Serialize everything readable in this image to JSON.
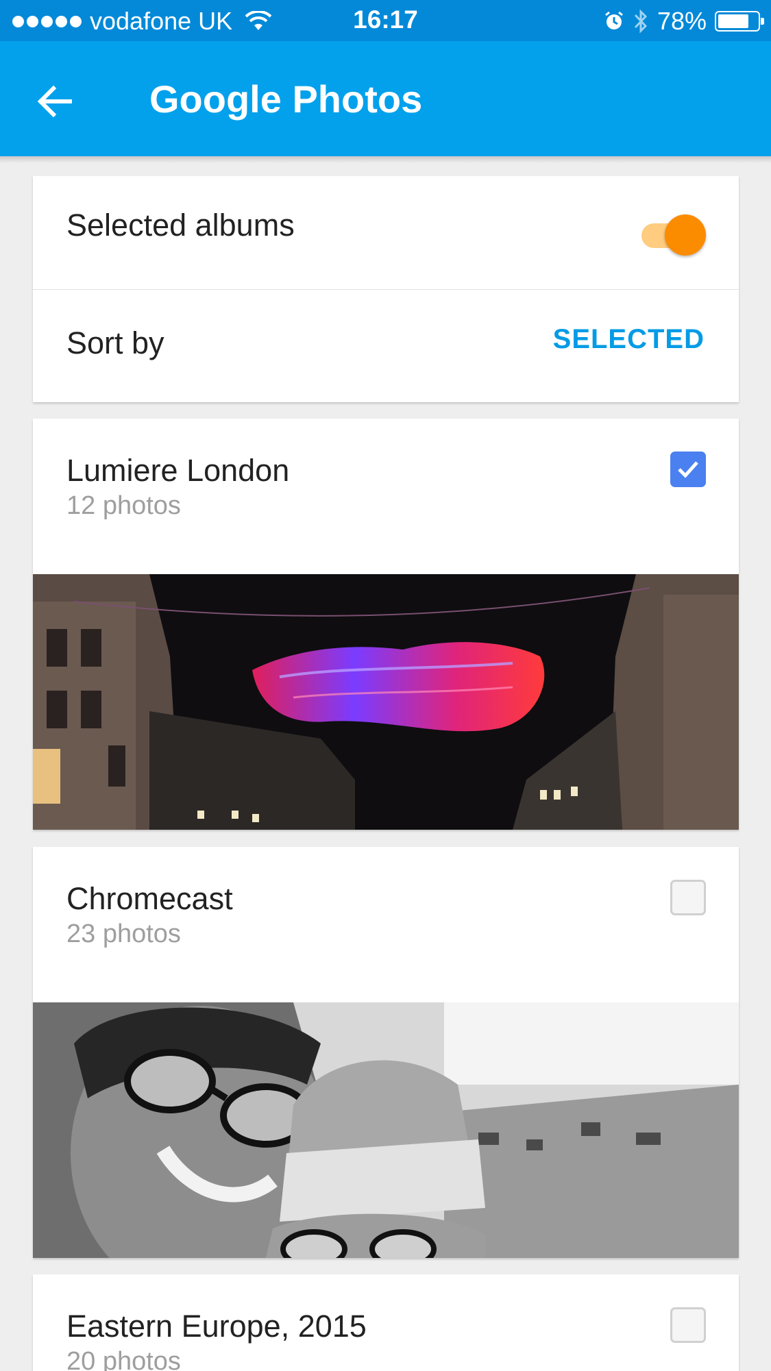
{
  "status_bar": {
    "carrier": "vodafone UK",
    "time": "16:17",
    "battery": "78%",
    "battery_level": 0.78
  },
  "app_bar": {
    "title": "Google Photos",
    "back_icon": "arrow-left-icon"
  },
  "settings": {
    "selected_albums_label": "Selected albums",
    "selected_albums_on": true,
    "sort_by_label": "Sort by",
    "sort_by_value": "SELECTED"
  },
  "albums": [
    {
      "name": "Lumiere London",
      "count": "12 photos",
      "checked": true
    },
    {
      "name": "Chromecast",
      "count": "23 photos",
      "checked": false
    },
    {
      "name": "Eastern Europe, 2015",
      "count": "20 photos",
      "checked": false
    }
  ],
  "colors": {
    "status_bar": "#0389d8",
    "app_bar": "#03a1ec",
    "accent": "#039be5",
    "toggle_on": "#fb8c00",
    "checkbox_on": "#4a80ef"
  }
}
